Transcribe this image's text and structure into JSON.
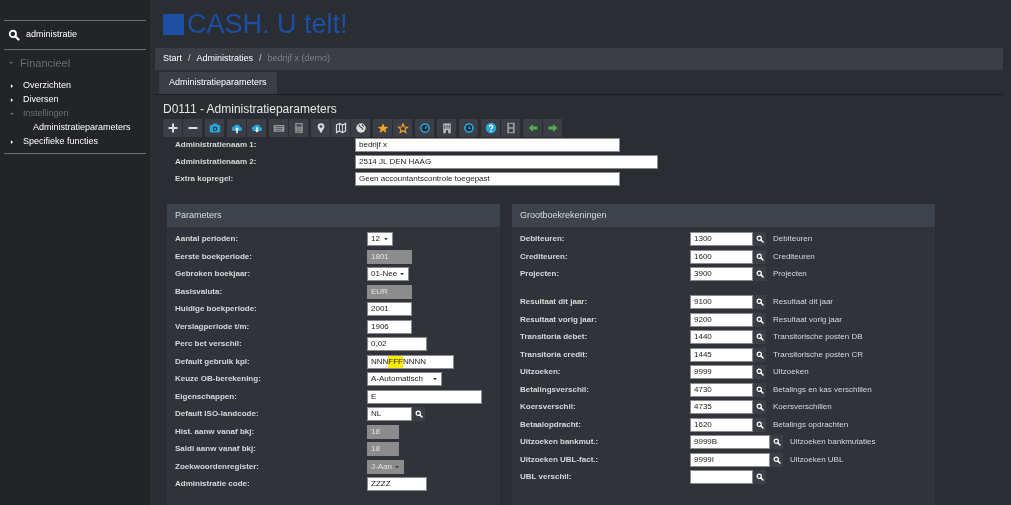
{
  "sidebar": {
    "search": {
      "value": "administratie"
    },
    "menu": {
      "label": "Financieel",
      "expanded": true,
      "children": [
        {
          "label": "Overzichten",
          "expanded": false
        },
        {
          "label": "Diversen",
          "expanded": false
        },
        {
          "label": "Instellingen",
          "expanded": true,
          "children": [
            {
              "label": "Administratieparameters"
            }
          ]
        },
        {
          "label": "Specifieke functies",
          "expanded": false
        }
      ]
    }
  },
  "logo": {
    "text": "CASH. U telt!"
  },
  "breadcrumb": [
    {
      "kind": "link",
      "label": "Start"
    },
    {
      "kind": "separator",
      "label": "/"
    },
    {
      "kind": "link",
      "label": "Administraties"
    },
    {
      "kind": "separator",
      "label": "/"
    },
    {
      "kind": "current",
      "label": "bedrijf x (demo)"
    }
  ],
  "tabs": [
    {
      "label": "Administratieparameters",
      "selected": true
    }
  ],
  "page_title": "D0111 - Administratieparameters",
  "toolbar": [
    [
      {
        "kind": "plus"
      },
      {
        "kind": "minus"
      }
    ],
    [
      {
        "kind": "camera"
      }
    ],
    [
      {
        "kind": "cloud-upload"
      },
      {
        "kind": "cloud-download"
      }
    ],
    [
      {
        "kind": "keyboard"
      },
      {
        "kind": "calculator"
      }
    ],
    [
      {
        "kind": "pin"
      },
      {
        "kind": "map"
      },
      {
        "kind": "globe"
      }
    ],
    [
      {
        "kind": "star"
      },
      {
        "kind": "star-outline"
      }
    ],
    [
      {
        "kind": "gauge"
      }
    ],
    [
      {
        "kind": "building"
      }
    ],
    [
      {
        "kind": "refresh"
      }
    ],
    [
      {
        "kind": "help"
      },
      {
        "kind": "film"
      }
    ],
    [
      {
        "kind": "arrow-left"
      },
      {
        "kind": "arrow-right"
      }
    ]
  ],
  "header_fields": [
    {
      "label": "Administratienaam 1:",
      "value": "bedrijf x"
    },
    {
      "label": "Administratienaam 2:",
      "value": "2514 JL DEN HAAG"
    },
    {
      "label": "Extra kopregel:",
      "value": "Geen accountantscontrole toegepast"
    }
  ],
  "parameters": {
    "title": "Parameters",
    "rows": [
      {
        "label": "Aantal perioden:",
        "kind": "select",
        "value": "12",
        "disabled": false
      },
      {
        "label": "Eerste boekperiode:",
        "kind": "input",
        "value": "1801",
        "disabled": true
      },
      {
        "label": "Gebroken boekjaar:",
        "kind": "select",
        "value": "01-Nee",
        "disabled": false
      },
      {
        "label": "Basisvaluta:",
        "kind": "input",
        "value": "EUR",
        "disabled": true
      },
      {
        "label": "Huidige boekperiode:",
        "kind": "input",
        "value": "2001",
        "disabled": false
      },
      {
        "label": "Verslagperiode t/m:",
        "kind": "input",
        "value": "1906",
        "disabled": false
      },
      {
        "label": "Perc bet verschil:",
        "kind": "input",
        "value": "0,02",
        "disabled": false
      },
      {
        "label": "Default gebruik kpl:",
        "kind": "segmented",
        "segments": [
          {
            "text": "NNN",
            "highlighted": false
          },
          {
            "text": "FFF",
            "highlighted": true
          },
          {
            "text": "NNNN",
            "highlighted": false
          }
        ],
        "disabled": false
      },
      {
        "label": "Keuze OB-berekening:",
        "kind": "select",
        "value": "A-Automatisch",
        "disabled": false
      },
      {
        "label": "Eigenschappen:",
        "kind": "input",
        "value": "E",
        "disabled": false
      },
      {
        "label": "Default ISO-landcode:",
        "kind": "lookup",
        "value": "NL",
        "disabled": false
      },
      {
        "label": "Hist. aanw vanaf bkj:",
        "kind": "input",
        "value": "18",
        "disabled": true
      },
      {
        "label": "Saldi aanw vanaf bkj:",
        "kind": "input",
        "value": "18",
        "disabled": true
      },
      {
        "label": "Zoekwoordenregister:",
        "kind": "select",
        "value": "J-Aan",
        "disabled": true
      },
      {
        "label": "Administratie code:",
        "kind": "input",
        "value": "ZZZZ",
        "disabled": false
      }
    ]
  },
  "ledger": {
    "title": "Grootboekrekeningen",
    "groups": [
      [
        {
          "label": "Debiteuren:",
          "value": "1300",
          "description": "Debiteuren"
        },
        {
          "label": "Crediteuren:",
          "value": "1600",
          "description": "Crediteuren"
        },
        {
          "label": "Projecten:",
          "value": "3900",
          "description": "Projecten"
        }
      ],
      [
        {
          "label": "Resultaat dit jaar:",
          "value": "9100",
          "description": "Resultaat dit jaar"
        },
        {
          "label": "Resultaat vorig jaar:",
          "value": "9200",
          "description": "Resultaat vorig jaar"
        },
        {
          "label": "Transitoria debet:",
          "value": "1440",
          "description": "Transitorische posten DB"
        },
        {
          "label": "Transitoria credit:",
          "value": "1445",
          "description": "Transitorische posten CR"
        },
        {
          "label": "Uitzoeken:",
          "value": "9999",
          "description": "Uitzoeken"
        },
        {
          "label": "Betalingsverschil:",
          "value": "4730",
          "description": "Betalings en kas verschillen"
        },
        {
          "label": "Koersverschil:",
          "value": "4735",
          "description": "Koersverschillen"
        },
        {
          "label": "Betaalopdracht:",
          "value": "1620",
          "description": "Betalings opdrachten"
        },
        {
          "label": "Uitzoeken bankmut.:",
          "value": "9999B",
          "description": "Uitzoeken bankmutaties"
        },
        {
          "label": "Uitzoeken UBL-fact.:",
          "value": "9999I",
          "description": "Uitzoeken UBL"
        },
        {
          "label": "UBL verschil:"
        }
      ]
    ]
  }
}
